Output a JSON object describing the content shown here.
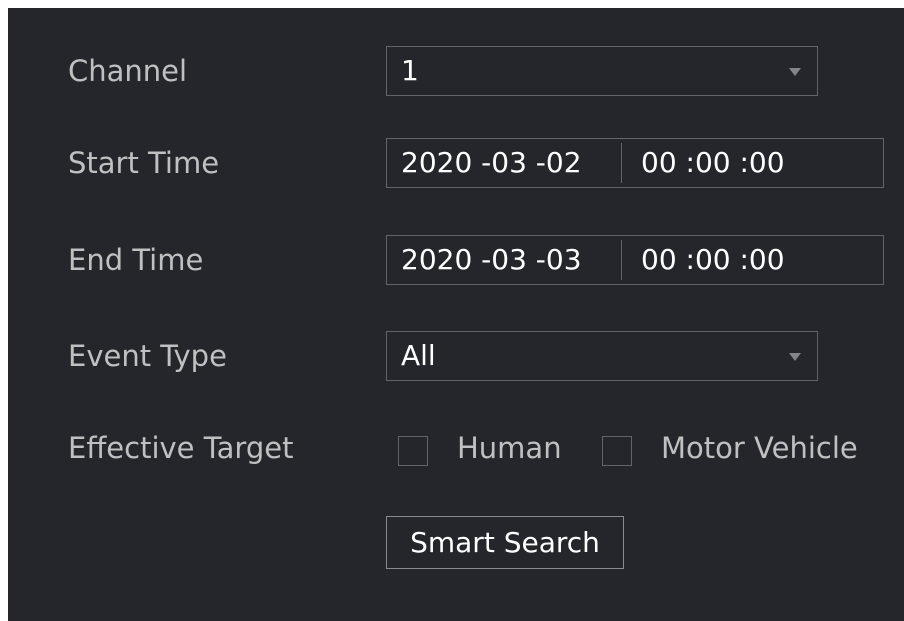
{
  "form": {
    "channel": {
      "label": "Channel",
      "value": "1",
      "icon": "dropdown-arrow-icon"
    },
    "start_time": {
      "label": "Start Time",
      "date": "2020 -03 -02",
      "time": "00 :00 :00"
    },
    "end_time": {
      "label": "End Time",
      "date": "2020 -03 -03",
      "time": "00 :00 :00"
    },
    "event_type": {
      "label": "Event Type",
      "value": "All",
      "icon": "dropdown-arrow-icon"
    },
    "effective_target": {
      "label": "Effective Target",
      "options": [
        {
          "label": "Human",
          "checked": false
        },
        {
          "label": "Motor Vehicle",
          "checked": false
        }
      ]
    },
    "smart_search_label": "Smart Search"
  },
  "colors": {
    "background": "#25262b",
    "border": "#63646a",
    "label_text": "#c0c0c0",
    "value_text": "#ffffff"
  }
}
